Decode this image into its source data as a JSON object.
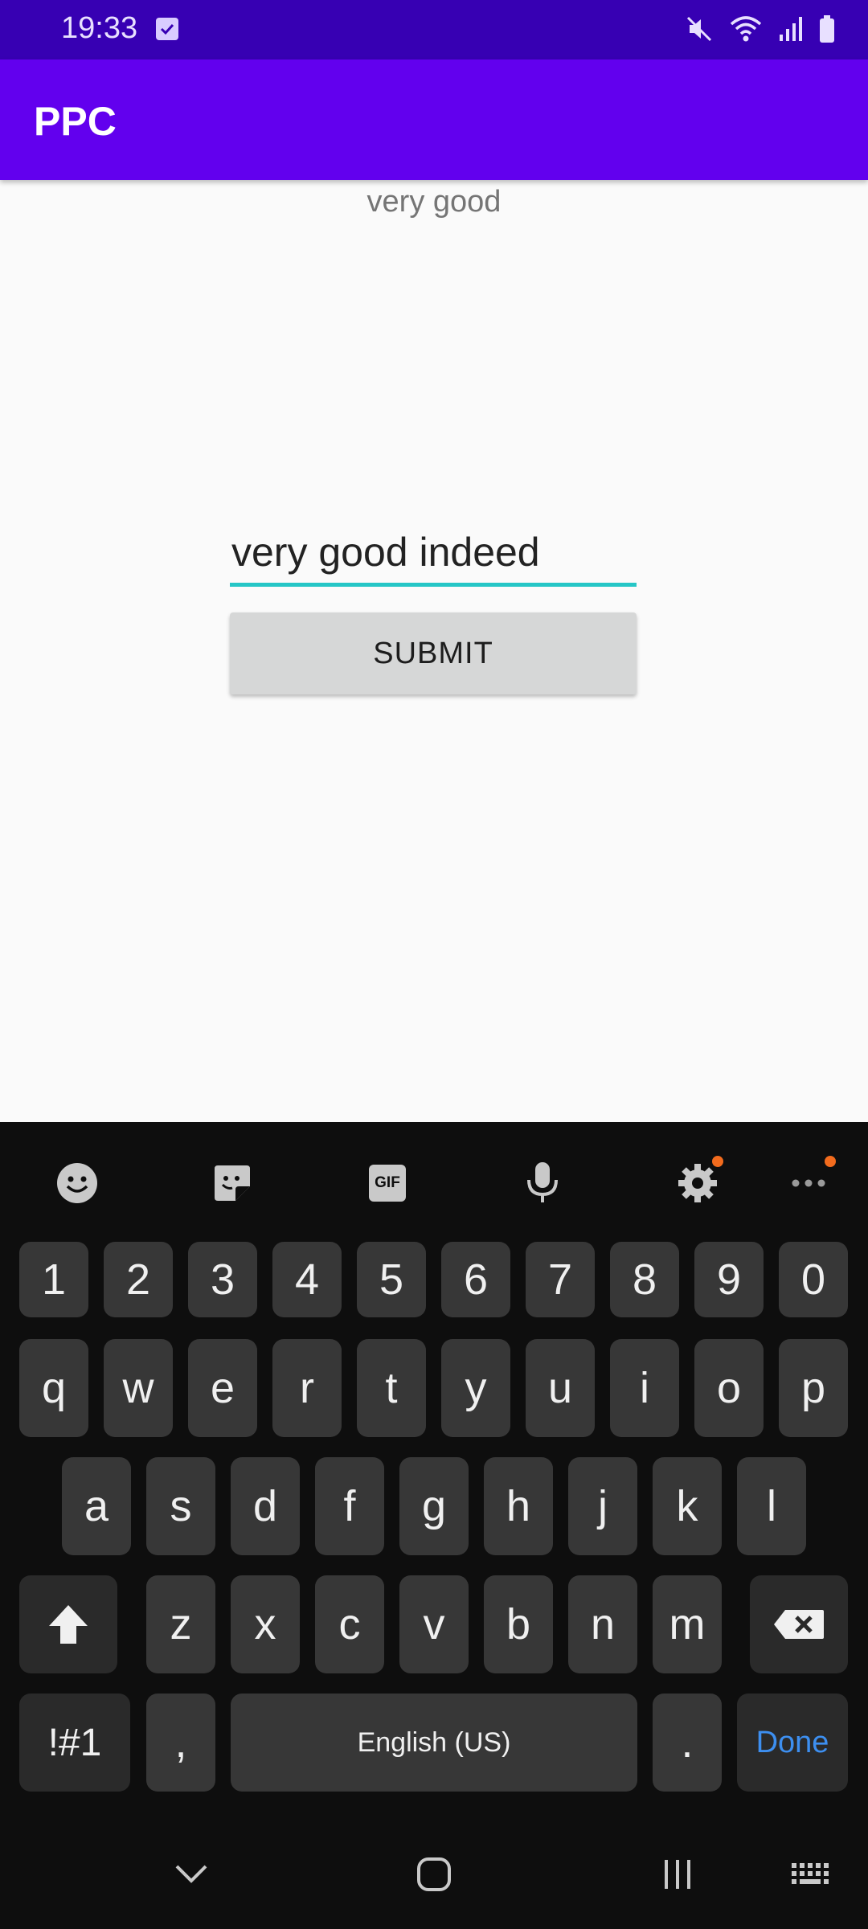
{
  "status_bar": {
    "time": "19:33",
    "icons": [
      "checkbox-notification-icon",
      "mute-icon",
      "wifi-icon",
      "signal-icon",
      "battery-icon"
    ]
  },
  "app_bar": {
    "title": "PPC"
  },
  "main": {
    "result_text": "very good",
    "input_value": "very good indeed",
    "submit_label": "SUBMIT"
  },
  "keyboard": {
    "toolbar": [
      "emoji-icon",
      "sticker-icon",
      "gif-icon",
      "microphone-icon",
      "settings-icon",
      "more-icon"
    ],
    "gif_label": "GIF",
    "row_numbers": [
      "1",
      "2",
      "3",
      "4",
      "5",
      "6",
      "7",
      "8",
      "9",
      "0"
    ],
    "row_top": [
      "q",
      "w",
      "e",
      "r",
      "t",
      "y",
      "u",
      "i",
      "o",
      "p"
    ],
    "row_middle": [
      "a",
      "s",
      "d",
      "f",
      "g",
      "h",
      "j",
      "k",
      "l"
    ],
    "row_bottom": [
      "z",
      "x",
      "c",
      "v",
      "b",
      "n",
      "m"
    ],
    "symbols_label": "!#1",
    "comma_label": ",",
    "space_label": "English (US)",
    "period_label": ".",
    "done_label": "Done"
  },
  "nav_bar": [
    "hide-keyboard-icon",
    "home-icon",
    "recents-icon",
    "keyboard-switch-icon"
  ],
  "colors": {
    "status_bar": "#3700b3",
    "app_bar": "#6200ee",
    "input_underline": "#26c6c6",
    "done_key": "#3d8ff0",
    "notification_dot": "#f26b1d"
  }
}
